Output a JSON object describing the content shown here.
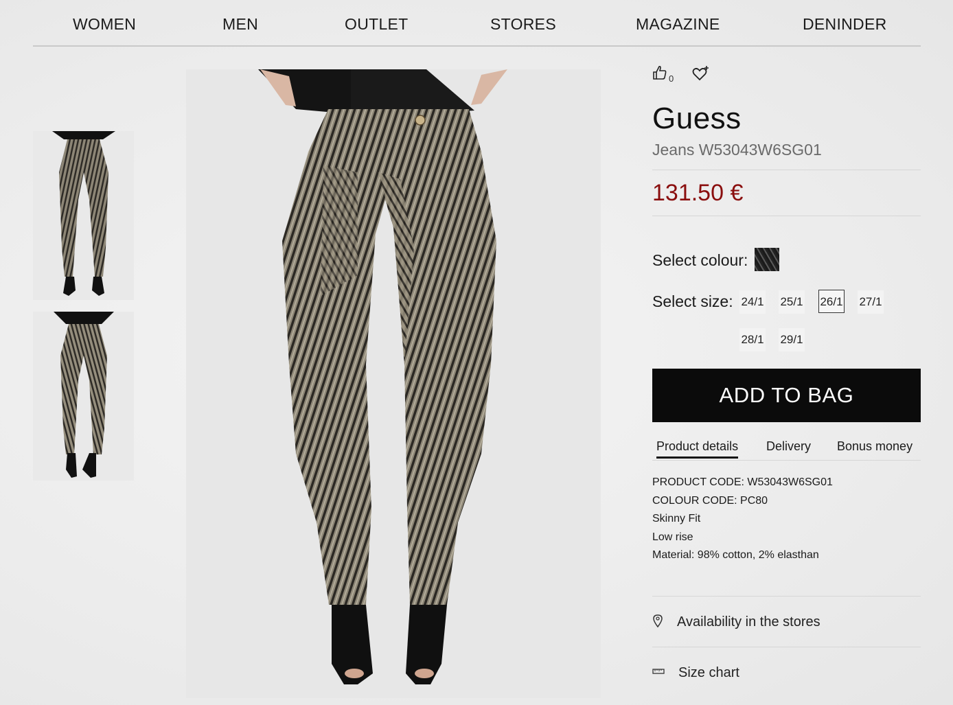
{
  "nav": {
    "items": [
      "WOMEN",
      "MEN",
      "OUTLET",
      "STORES",
      "MAGAZINE",
      "DENINDER"
    ]
  },
  "social": {
    "like_count": "0",
    "like_icon": "thumbs-up-icon",
    "wishlist_icon": "heart-plus-icon"
  },
  "product": {
    "brand": "Guess",
    "name": "Jeans W53043W6SG01",
    "price": "131.50 €",
    "price_color": "#8a0e0e"
  },
  "colour": {
    "label": "Select colour:"
  },
  "size": {
    "label": "Select size:",
    "options": [
      "24/1",
      "25/1",
      "26/1",
      "27/1",
      "28/1",
      "29/1"
    ],
    "selected": "26/1"
  },
  "cta": {
    "add_to_bag": "ADD TO BAG"
  },
  "tabs": {
    "items": [
      "Product details",
      "Delivery",
      "Bonus money"
    ],
    "active": "Product details"
  },
  "details": {
    "lines": [
      "PRODUCT CODE: W53043W6SG01",
      "COLOUR CODE: PC80",
      "Skinny Fit",
      "Low rise",
      "Material: 98% cotton, 2% elasthan"
    ]
  },
  "links": {
    "availability": "Availability in the stores",
    "size_chart": "Size chart"
  }
}
